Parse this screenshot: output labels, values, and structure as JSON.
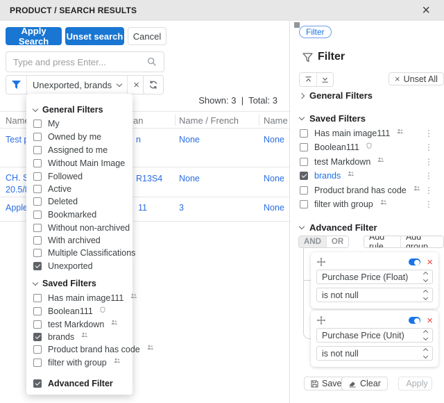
{
  "window": {
    "title": "PRODUCT / SEARCH RESULTS",
    "close_icon": "close"
  },
  "toolbar": {
    "apply_label": "Apply Search",
    "unset_label": "Unset search",
    "cancel_label": "Cancel"
  },
  "search": {
    "placeholder": "Type and press Enter..."
  },
  "filter_bar": {
    "selected_value": "Unexported, brands"
  },
  "results": {
    "shown": "Shown: 3",
    "separator": "|",
    "total": "Total: 3"
  },
  "table": {
    "columns": {
      "c1": "Name",
      "c2_fragment": "an",
      "c3": "Name / French",
      "c4": "Name"
    },
    "rows": [
      {
        "name_fragment": "Test p",
        "col2_fragment": "n",
        "french": "None",
        "name4": "None"
      },
      {
        "name_fragment": "CH. S",
        "name_fragment_line2": "20.5/8",
        "col2_fragment": "R13S4",
        "french": "None",
        "name4": "None"
      },
      {
        "name_fragment": "Apple",
        "col2_fragment": "11",
        "french": "3",
        "name4": "None"
      }
    ]
  },
  "dropdown": {
    "general_header": "General Filters",
    "general_items": [
      {
        "label": "My",
        "checked": false
      },
      {
        "label": "Owned by me",
        "checked": false
      },
      {
        "label": "Assigned to me",
        "checked": false
      },
      {
        "label": "Without Main Image",
        "checked": false
      },
      {
        "label": "Followed",
        "checked": false
      },
      {
        "label": "Active",
        "checked": false
      },
      {
        "label": "Deleted",
        "checked": false
      },
      {
        "label": "Bookmarked",
        "checked": false
      },
      {
        "label": "Without non-archived",
        "checked": false
      },
      {
        "label": "With archived",
        "checked": false
      },
      {
        "label": "Multiple Classifications",
        "checked": false
      },
      {
        "label": "Unexported",
        "checked": true
      }
    ],
    "saved_header": "Saved Filters",
    "saved_items": [
      {
        "label": "Has main image111",
        "icon": "users-icon",
        "checked": false
      },
      {
        "label": "Boolean111",
        "icon": "shield-icon",
        "checked": false
      },
      {
        "label": "test Markdown",
        "icon": "users-icon",
        "checked": false
      },
      {
        "label": "brands",
        "icon": "users-icon",
        "checked": true
      },
      {
        "label": "Product brand has code",
        "icon": "users-icon",
        "checked": false
      },
      {
        "label": "filter with group",
        "icon": "users-icon",
        "checked": false
      }
    ],
    "advanced_label": "Advanced Filter",
    "advanced_checked": true
  },
  "panel": {
    "chip_label": "Filter",
    "title": "Filter",
    "unset_all_label": "Unset All",
    "general_header": "General Filters",
    "saved_header": "Saved Filters",
    "saved_items": [
      {
        "label": "Has main image111",
        "icon": "users-icon",
        "checked": false
      },
      {
        "label": "Boolean111",
        "icon": "shield-icon",
        "checked": false
      },
      {
        "label": "test Markdown",
        "icon": "users-icon",
        "checked": false
      },
      {
        "label": "brands",
        "icon": "users-icon",
        "checked": true
      },
      {
        "label": "Product brand has code",
        "icon": "users-icon",
        "checked": false
      },
      {
        "label": "filter with group",
        "icon": "users-icon",
        "checked": false
      }
    ],
    "advanced": {
      "header": "Advanced Filter",
      "enabled": true,
      "and_label": "AND",
      "or_label": "OR",
      "active_operator": "AND",
      "add_rule_label": "Add rule",
      "add_group_label": "Add group",
      "rules": [
        {
          "field": "Purchase Price (Float)",
          "operator": "is not null",
          "enabled": true
        },
        {
          "field": "Purchase Price (Unit)",
          "operator": "is not null",
          "enabled": true
        }
      ]
    },
    "footer": {
      "save_label": "Save",
      "clear_label": "Clear",
      "apply_label": "Apply"
    }
  },
  "colors": {
    "accent_blue": "#1a73e8",
    "button_blue": "#1976d2",
    "link_blue": "#2b6de4",
    "danger_red": "#ef4040",
    "checked_gray": "#5f6368",
    "header_gray": "#e7e7e7"
  }
}
